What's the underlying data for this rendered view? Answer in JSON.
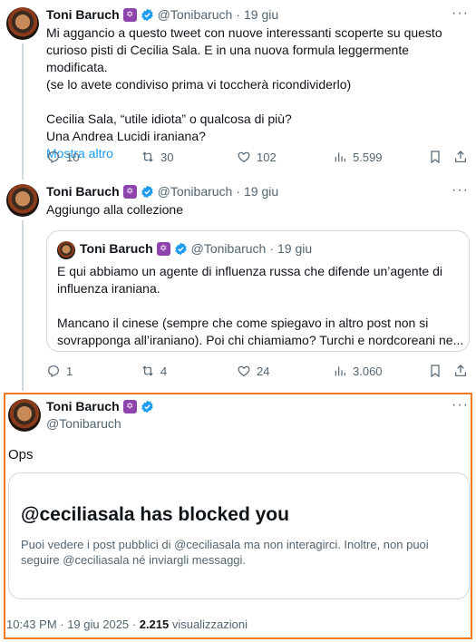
{
  "tweet1": {
    "name": "Toni Baruch",
    "handle": "@Tonibaruch",
    "sep": "·",
    "date": "19 giu",
    "menu": "···",
    "line1": "Mi aggancio a questo tweet con nuove interessanti scoperte su questo",
    "line2": "curioso pisti di Cecilia Sala. E in una nuova formula leggermente modificata.",
    "line3": "(se lo avete condiviso prima vi toccherà ricondividerlo)",
    "line4": "Cecilia Sala, “utile idiota” o qualcosa di più?",
    "line5": "Una Andrea Lucidi iraniana?",
    "show_more": "Mostra altro",
    "replies": "10",
    "reposts": "30",
    "likes": "102",
    "views": "5.599"
  },
  "tweet2": {
    "name": "Toni Baruch",
    "handle": "@Tonibaruch",
    "sep": "·",
    "date": "19 giu",
    "menu": "···",
    "text": "Aggiungo alla collezione",
    "quote": {
      "name": "Toni Baruch",
      "handle": "@Tonibaruch",
      "sep": "·",
      "date": "19 giu",
      "line1": "E qui abbiamo un agente di influenza russa che difende un’agente di",
      "line2": "influenza iraniana.",
      "line3": "Mancano il cinese (sempre che come spiegavo in altro post non si",
      "line4": "sovrapponga all’iraniano). Poi chi chiamiamo? Turchi e nordcoreani ne..."
    },
    "replies": "1",
    "reposts": "4",
    "likes": "24",
    "views": "3.060"
  },
  "main": {
    "name": "Toni Baruch",
    "handle": "@Tonibaruch",
    "menu": "···",
    "text": "Ops",
    "card_title": "@ceciliasala has blocked you",
    "card_line1": "Puoi vedere i post pubblici di @ceciliasala ma non interagirci. Inoltre, non puoi",
    "card_line2": "seguire @ceciliasala né inviargli messaggi.",
    "timestamp": "10:43 PM · 19 giu 2025 ·",
    "views_count": "2.215",
    "views_label": "visualizzazioni"
  },
  "colors": {
    "accent": "#1d9bf0",
    "highlight": "#f07a1e",
    "badge": "#8e44ad"
  },
  "icons": [
    "reply-icon",
    "repost-icon",
    "like-icon",
    "views-icon",
    "bookmark-icon",
    "share-icon",
    "verified-icon",
    "star-of-david-badge-icon",
    "more-icon"
  ]
}
